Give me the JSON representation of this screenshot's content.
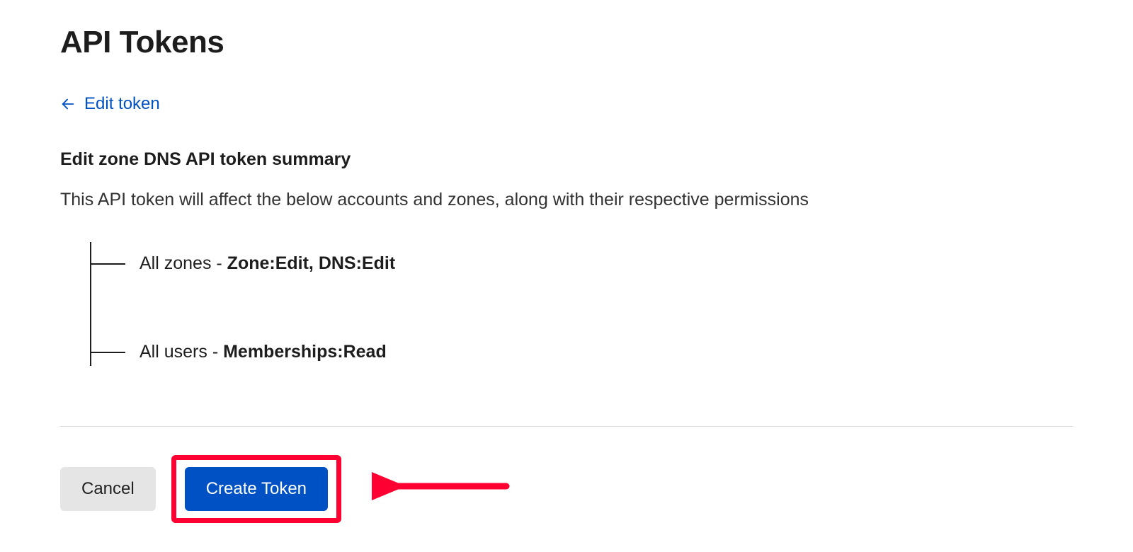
{
  "page": {
    "title": "API Tokens",
    "backlink": "Edit token",
    "summary_heading": "Edit zone DNS API token summary",
    "description": "This API token will affect the below accounts and zones, along with their respective permissions",
    "resources": [
      {
        "scope": "All zones",
        "perms": "Zone:Edit, DNS:Edit"
      },
      {
        "scope": "All users",
        "perms": "Memberships:Read"
      }
    ],
    "actions": {
      "cancel": "Cancel",
      "create": "Create Token"
    }
  },
  "colors": {
    "link": "#0051c3",
    "primary": "#0051c3",
    "highlight": "#ff0033"
  }
}
